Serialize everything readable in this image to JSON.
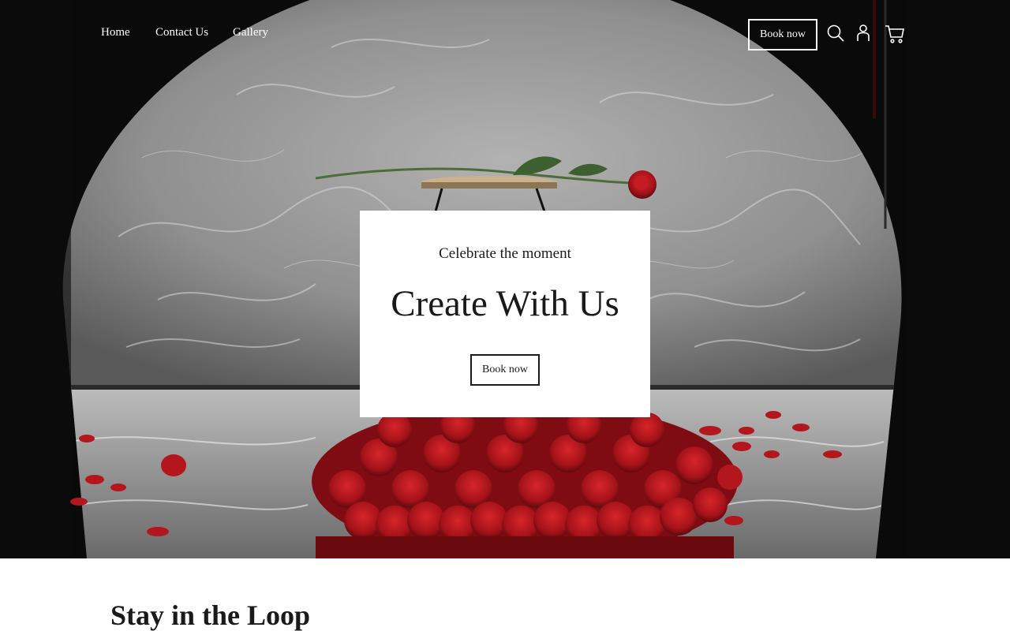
{
  "nav": {
    "links": [
      "Home",
      "Contact Us",
      "Gallery"
    ],
    "book_label": "Book now",
    "icons": [
      "search-icon",
      "account-icon",
      "cart-icon"
    ]
  },
  "hero": {
    "subtitle": "Celebrate the moment",
    "title": "Create With Us",
    "button_label": "Book now",
    "colors": {
      "rose": "#b0161c",
      "backdrop": "#8a8a8a",
      "dark": "#080808"
    }
  },
  "newsletter": {
    "title": "Stay in the Loop"
  }
}
